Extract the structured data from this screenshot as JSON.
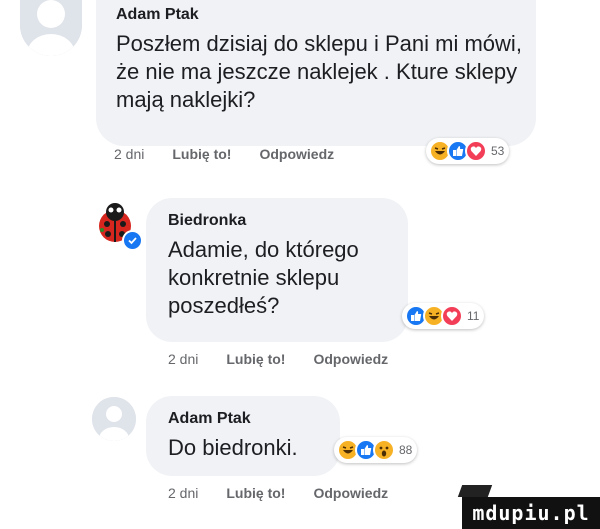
{
  "comments": [
    {
      "author": "Adam Ptak",
      "text": "Poszłem dzisiaj do sklepu i Pani mi mówi, że nie ma jeszcze naklejek . Kture sklepy mają naklejki?",
      "time": "2 dni",
      "like_label": "Lubię to!",
      "reply_label": "Odpowiedz",
      "reactions": [
        "haha",
        "like",
        "love"
      ],
      "reaction_count": "53"
    },
    {
      "author": "Biedronka",
      "verified": true,
      "text": "Adamie, do którego konkretnie sklepu poszedłeś?",
      "time": "2 dni",
      "like_label": "Lubię to!",
      "reply_label": "Odpowiedz",
      "reactions": [
        "like",
        "haha",
        "love"
      ],
      "reaction_count": "11"
    },
    {
      "author": "Adam Ptak",
      "text": "Do biedronki.",
      "time": "2 dni",
      "like_label": "Lubię to!",
      "reply_label": "Odpowiedz",
      "reactions": [
        "haha",
        "like",
        "wow"
      ],
      "reaction_count": "88"
    }
  ],
  "watermark": "mdupiu.pl",
  "colors": {
    "bubble": "#f0f2f5",
    "meta_text": "#65676b",
    "like": "#1877f2",
    "love": "#f33e58",
    "haha": "#f7b125",
    "verified": "#1877f2",
    "ladybug_red": "#d7261e"
  }
}
